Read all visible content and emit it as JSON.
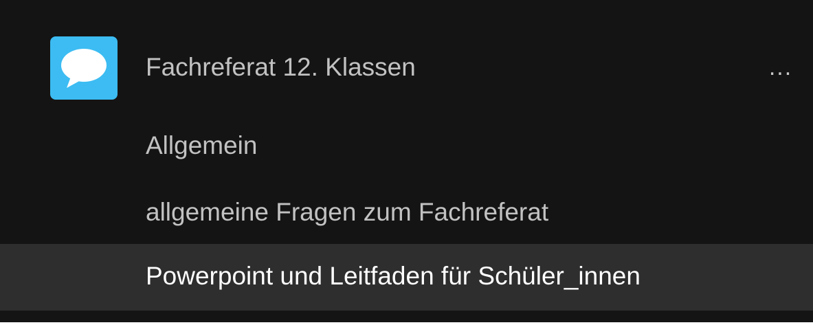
{
  "team": {
    "name": "Fachreferat 12. Klassen",
    "icon": "speech-bubble-icon",
    "icon_color": "#3cbcf2",
    "more_label": "..."
  },
  "channels": [
    {
      "label": "Allgemein",
      "selected": false
    },
    {
      "label": "allgemeine Fragen zum Fachreferat",
      "selected": false
    },
    {
      "label": "Powerpoint und Leitfaden für Schüler_innen",
      "selected": true
    }
  ],
  "colors": {
    "background": "#141414",
    "selected_row": "#2e2e2e",
    "text": "#c2c2c2",
    "selected_text": "#ffffff"
  }
}
